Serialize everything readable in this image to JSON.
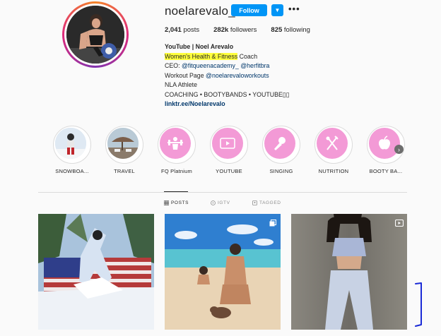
{
  "profile": {
    "username": "noelarevalo_",
    "follow_label": "Follow",
    "dropdown_icon": "chevron-down-icon",
    "more_icon": "more-options-icon",
    "stats": {
      "posts_count": "2,041",
      "posts_label": "posts",
      "followers_count": "282k",
      "followers_label": "followers",
      "following_count": "825",
      "following_label": "following"
    },
    "bio": {
      "name": "YouTube | Noel Arevalo",
      "line1_highlight": "Women's Health & Fitness",
      "line1_rest": " Coach",
      "line2_prefix": "CEO: ",
      "line2_mention1": "@fitqueenacademy_",
      "line2_mention2": "@herfitbra",
      "line3_prefix": "Workout Page ",
      "line3_mention": "@noelarevaloworkouts",
      "line4": "NLA Athlete",
      "line5": "COACHING • BOOTYBANDS • YOUTUBE▯▯",
      "link": "linktr.ee/Noelarevalo"
    }
  },
  "highlights": [
    {
      "label": "SNOWBOA...",
      "icon": "snowboard-photo"
    },
    {
      "label": "TRAVEL",
      "icon": "travel-photo"
    },
    {
      "label": "FQ Platnium",
      "icon": "barbell-icon"
    },
    {
      "label": "YOUTUBE",
      "icon": "video-icon"
    },
    {
      "label": "SINGING",
      "icon": "microphone-icon"
    },
    {
      "label": "NUTRITION",
      "icon": "utensils-icon"
    },
    {
      "label": "BOOTY BA...",
      "icon": "apple-icon"
    }
  ],
  "tabs": [
    {
      "label": "POSTS",
      "icon": "grid-icon",
      "active": true
    },
    {
      "label": "IGTV",
      "icon": "igtv-icon",
      "active": false
    },
    {
      "label": "TAGGED",
      "icon": "tag-icon",
      "active": false
    }
  ],
  "posts": [
    {
      "icon": "",
      "desc_icon": "snow-flag-photo"
    },
    {
      "icon": "carousel-icon",
      "desc_icon": "beach-photo"
    },
    {
      "icon": "video-icon",
      "desc_icon": "outfit-photo"
    }
  ],
  "colors": {
    "accent": "#0095f6",
    "highlight_pink": "#f39ad6",
    "marker_yellow": "#ffff3c",
    "pen_blue": "#1b2bd6"
  }
}
